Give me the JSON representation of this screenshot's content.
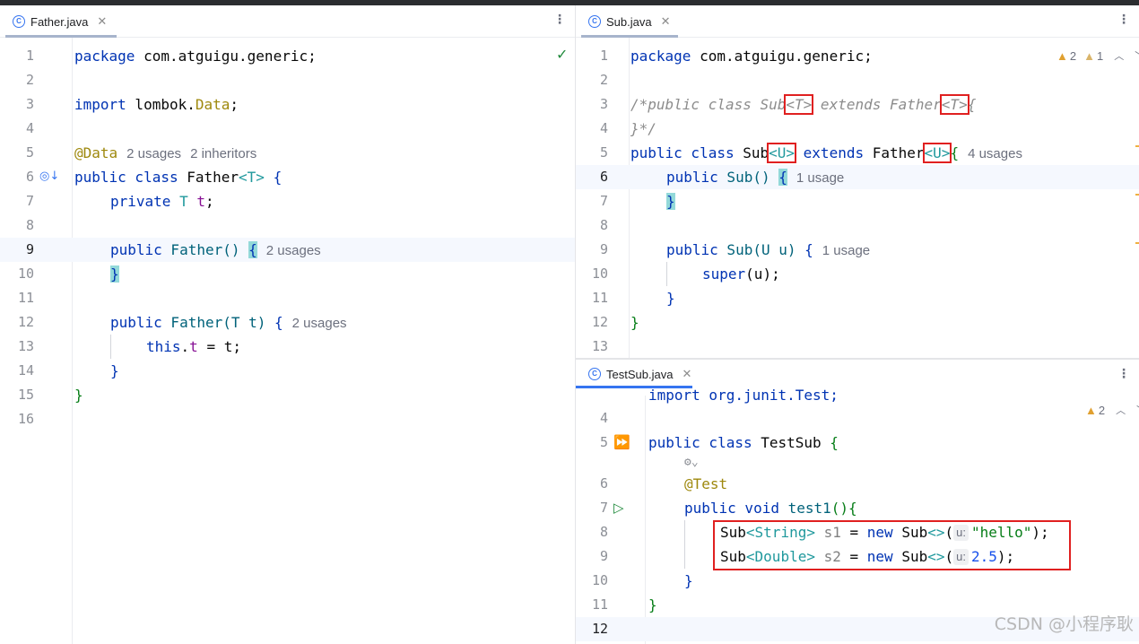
{
  "left_pane": {
    "tab": {
      "label": "Father.java",
      "icon": "class-icon"
    },
    "status": "check-icon",
    "lines": [
      {
        "n": "1",
        "parts": {
          "a": "package",
          "b": " com.atguigu.generic;"
        }
      },
      {
        "n": "2"
      },
      {
        "n": "3",
        "parts": {
          "a": "import",
          "b": " lombok.",
          "c": "Data",
          "d": ";"
        }
      },
      {
        "n": "4"
      },
      {
        "n": "5",
        "parts": {
          "a": "@Data",
          "hint1": "2 usages",
          "hint2": "2 inheritors"
        }
      },
      {
        "n": "6",
        "parts": {
          "a": "public class",
          "b": " Father",
          "c": "<T>",
          "d": " {"
        }
      },
      {
        "n": "7",
        "parts": {
          "a": "private",
          "b": " T ",
          "c": "t",
          "d": ";"
        }
      },
      {
        "n": "8"
      },
      {
        "n": "9",
        "parts": {
          "a": "public",
          "b": " Father",
          "c": "()",
          "d": " ",
          "e": "{",
          "hint": "2 usages"
        }
      },
      {
        "n": "10",
        "parts": {
          "a": "}"
        }
      },
      {
        "n": "11"
      },
      {
        "n": "12",
        "parts": {
          "a": "public",
          "b": " Father",
          "c": "(T t)",
          "d": " {",
          "hint": "2 usages"
        }
      },
      {
        "n": "13",
        "parts": {
          "a": "this",
          "b": ".",
          "c": "t",
          "d": " = t;"
        }
      },
      {
        "n": "14",
        "parts": {
          "a": "}"
        }
      },
      {
        "n": "15",
        "parts": {
          "a": "}"
        }
      },
      {
        "n": "16"
      }
    ]
  },
  "right_top_pane": {
    "tab": {
      "label": "Sub.java",
      "icon": "class-icon"
    },
    "inspections": {
      "warnings": "2",
      "weak_warnings": "1"
    },
    "lines": [
      {
        "n": "1",
        "parts": {
          "a": "package",
          "b": " com.atguigu.generic;"
        }
      },
      {
        "n": "2"
      },
      {
        "n": "3",
        "parts": {
          "a": "/*public class Sub",
          "b": "<T>",
          "c": " extends Father",
          "d": "<T>",
          "e": "{"
        }
      },
      {
        "n": "4",
        "parts": {
          "a": "}*/"
        }
      },
      {
        "n": "5",
        "parts": {
          "a": "public class",
          "b": " Sub",
          "c": "<U>",
          "d": " extends",
          "e": " Father",
          "f": "<U>",
          "g": "{",
          "hint": "4 usages"
        }
      },
      {
        "n": "6",
        "parts": {
          "a": "public",
          "b": " Sub",
          "c": "()",
          "d": " ",
          "e": "{",
          "hint": "1 usage"
        }
      },
      {
        "n": "7",
        "parts": {
          "a": "}"
        }
      },
      {
        "n": "8"
      },
      {
        "n": "9",
        "parts": {
          "a": "public",
          "b": " Sub",
          "c": "(U u)",
          "d": " {",
          "hint": "1 usage"
        }
      },
      {
        "n": "10",
        "parts": {
          "a": "super",
          "b": "(u);"
        }
      },
      {
        "n": "11",
        "parts": {
          "a": "}"
        }
      },
      {
        "n": "12",
        "parts": {
          "a": "}"
        }
      },
      {
        "n": "13"
      }
    ]
  },
  "right_bottom_pane": {
    "tab": {
      "label": "TestSub.java",
      "icon": "test-class-icon"
    },
    "inspections": {
      "warnings": "2"
    },
    "lines": [
      {
        "n": "",
        "parts": {
          "a": "import org.junit.Test;"
        }
      },
      {
        "n": "4"
      },
      {
        "n": "5",
        "parts": {
          "a": "public class",
          "b": " TestSub",
          "c": " {"
        }
      },
      {
        "n": "",
        "parts": {
          "a": "⚙⌄"
        }
      },
      {
        "n": "6",
        "parts": {
          "a": "@Test"
        }
      },
      {
        "n": "7",
        "parts": {
          "a": "public void",
          "b": " test1",
          "c": "(){"
        }
      },
      {
        "n": "8",
        "parts": {
          "a": "Sub",
          "b": "<String>",
          "c": " s1",
          "d": " = ",
          "e": "new",
          "f": " Sub",
          "g": "<>",
          "h": "(",
          "inlay": "u:",
          "i": "\"hello\"",
          "j": ");"
        }
      },
      {
        "n": "9",
        "parts": {
          "a": "Sub",
          "b": "<Double>",
          "c": " s2",
          "d": " = ",
          "e": "new",
          "f": " Sub",
          "g": "<>",
          "h": "(",
          "inlay": "u:",
          "i": "2.5",
          "j": ");"
        }
      },
      {
        "n": "10",
        "parts": {
          "a": "}"
        }
      },
      {
        "n": "11",
        "parts": {
          "a": "}"
        }
      },
      {
        "n": "12"
      }
    ]
  },
  "watermark": "CSDN @小程序耿",
  "colors": {
    "keyword": "#0033b3",
    "method": "#00627a",
    "field": "#871094",
    "annotation": "#9e880d",
    "string": "#067d17",
    "number": "#1750eb",
    "generic": "#20999d",
    "comment": "#8c8c8c",
    "highlight_box": "#e02020",
    "tab_active": "#3574f0"
  }
}
